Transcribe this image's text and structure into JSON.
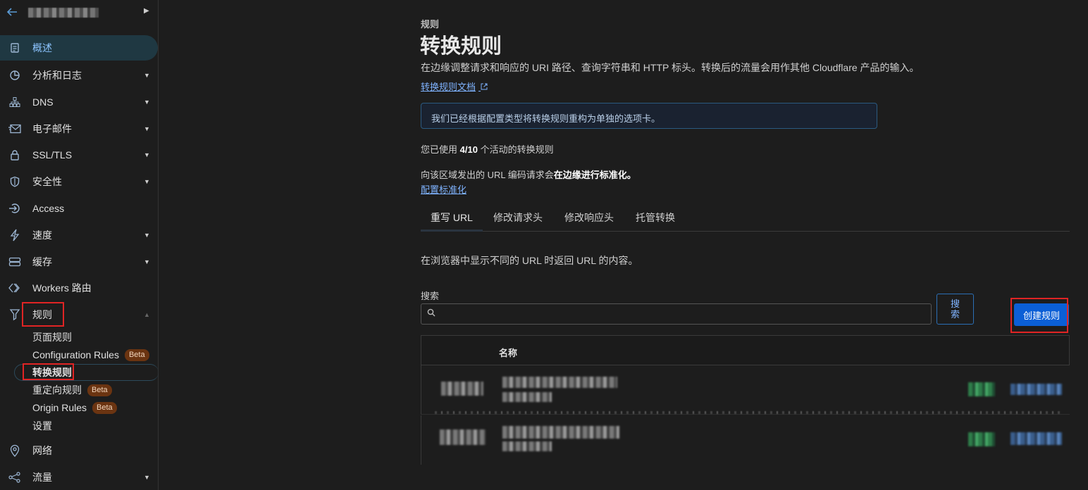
{
  "sidebar": {
    "account_name": "▒▒▒▒▒▒ ▒▒",
    "items": [
      {
        "label": "概述"
      },
      {
        "label": "分析和日志"
      },
      {
        "label": "DNS"
      },
      {
        "label": "电子邮件"
      },
      {
        "label": "SSL/TLS"
      },
      {
        "label": "安全性"
      },
      {
        "label": "Access"
      },
      {
        "label": "速度"
      },
      {
        "label": "缓存"
      },
      {
        "label": "Workers 路由"
      },
      {
        "label": "规则"
      },
      {
        "label": "网络"
      },
      {
        "label": "流量"
      }
    ],
    "rules_sub": [
      {
        "label": "页面规则"
      },
      {
        "label": "Configuration Rules",
        "badge": "Beta"
      },
      {
        "label": "转换规则"
      },
      {
        "label": "重定向规则",
        "badge": "Beta"
      },
      {
        "label": "Origin Rules",
        "badge": "Beta"
      },
      {
        "label": "设置"
      }
    ]
  },
  "main": {
    "breadcrumb": "规则",
    "title": "转换规则",
    "description": "在边缘调整请求和响应的 URI 路径、查询字符串和 HTTP 标头。转换后的流量会用作其他 Cloudflare 产品的输入。",
    "docs_link": "转换规则文档",
    "info_message": "我们已经根据配置类型将转换规则重构为单独的选项卡。",
    "usage_prefix": "您已使用",
    "usage_count": "4/10",
    "usage_suffix": "个活动的转换规则",
    "normalization_prefix": "向该区域发出的 URL 编码请求会",
    "normalization_bold": "在边缘进行标准化。",
    "normalization_link": "配置标准化",
    "tabs": [
      {
        "label": "重写 URL"
      },
      {
        "label": "修改请求头"
      },
      {
        "label": "修改响应头"
      },
      {
        "label": "托管转换"
      }
    ],
    "tab_description": "在浏览器中显示不同的 URL 时返回 URL 的内容。",
    "search_label": "搜索",
    "search_placeholder": "",
    "search_button_line1": "搜",
    "search_button_line2": "索",
    "create_button": "创建规则",
    "table": {
      "header_name": "名称"
    }
  },
  "colors": {
    "accent": "#0b5fd6",
    "link": "#7fb3ff",
    "highlight_box": "#e02424",
    "beta_badge": "#6b3411"
  }
}
